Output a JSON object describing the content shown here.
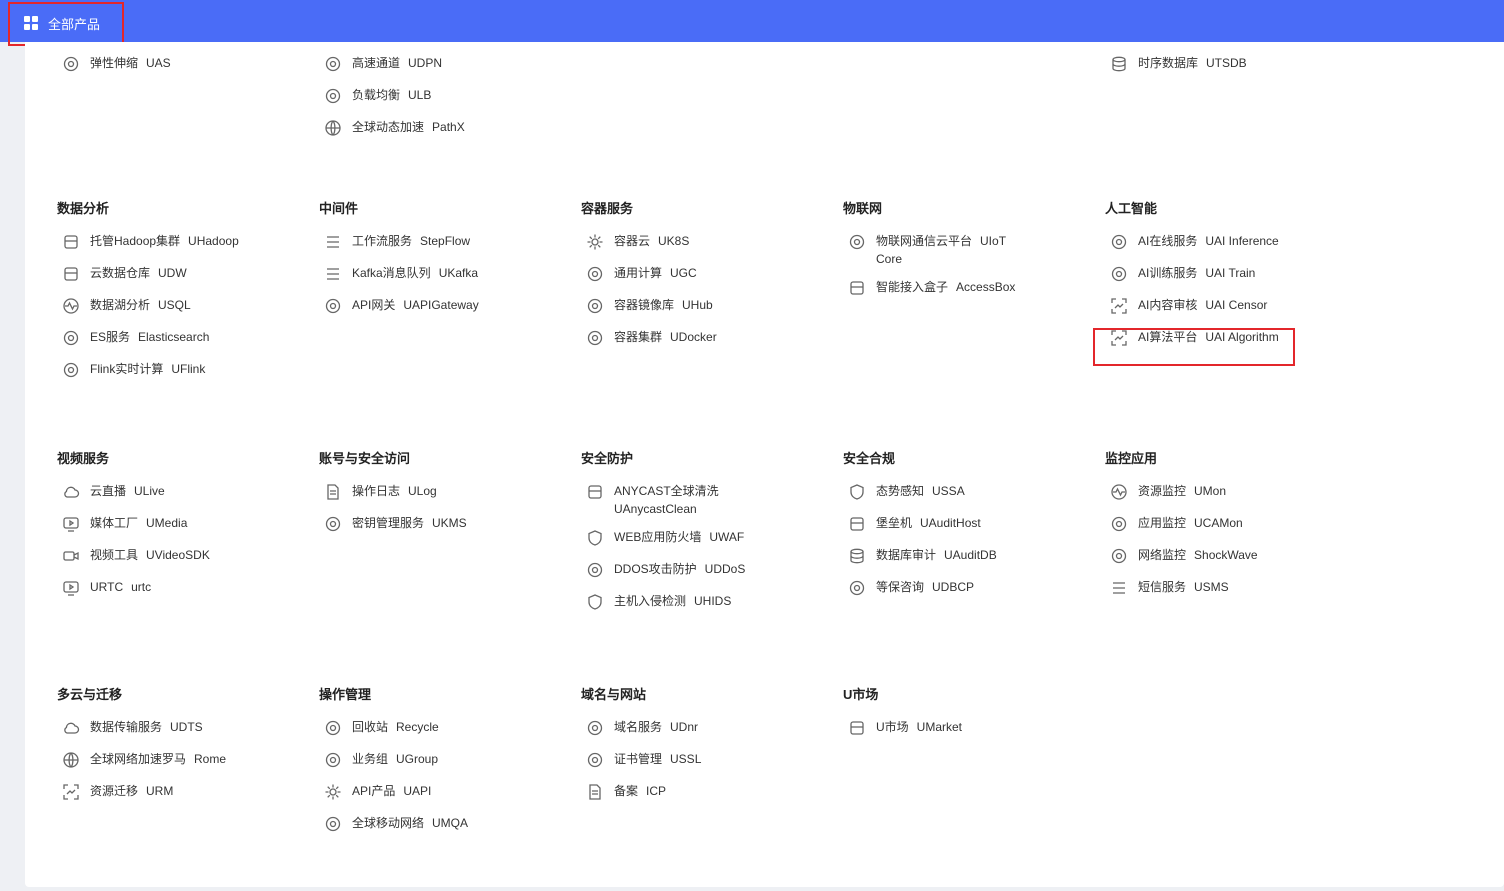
{
  "topbar": {
    "all_products_label": "全部产品"
  },
  "rows": [
    [
      {
        "title": "",
        "items": [
          {
            "name": "弹性伸缩",
            "code": "UAS",
            "icon": "scale-icon"
          }
        ]
      },
      {
        "title": "",
        "items": [
          {
            "name": "高速通道",
            "code": "UDPN",
            "icon": "channel-icon"
          },
          {
            "name": "负载均衡",
            "code": "ULB",
            "icon": "balance-icon"
          },
          {
            "name": "全球动态加速",
            "code": "PathX",
            "icon": "accelerate-icon"
          }
        ]
      },
      {
        "title": "",
        "items": []
      },
      {
        "title": "",
        "items": []
      },
      {
        "title": "",
        "items": [
          {
            "name": "时序数据库",
            "code": "UTSDB",
            "icon": "database-icon"
          }
        ]
      }
    ],
    [
      {
        "title": "数据分析",
        "items": [
          {
            "name": "托管Hadoop集群",
            "code": "UHadoop",
            "icon": "hadoop-icon"
          },
          {
            "name": "云数据仓库",
            "code": "UDW",
            "icon": "warehouse-icon"
          },
          {
            "name": "数据湖分析",
            "code": "USQL",
            "icon": "lake-icon"
          },
          {
            "name": "ES服务",
            "code": "Elasticsearch",
            "icon": "es-icon"
          },
          {
            "name": "Flink实时计算",
            "code": "UFlink",
            "icon": "flink-icon"
          }
        ]
      },
      {
        "title": "中间件",
        "items": [
          {
            "name": "工作流服务",
            "code": "StepFlow",
            "icon": "workflow-icon"
          },
          {
            "name": "Kafka消息队列",
            "code": "UKafka",
            "icon": "queue-icon"
          },
          {
            "name": "API网关",
            "code": "UAPIGateway",
            "icon": "gateway-icon"
          }
        ]
      },
      {
        "title": "容器服务",
        "items": [
          {
            "name": "容器云",
            "code": "UK8S",
            "icon": "k8s-icon"
          },
          {
            "name": "通用计算",
            "code": "UGC",
            "icon": "compute-icon"
          },
          {
            "name": "容器镜像库",
            "code": "UHub",
            "icon": "hub-icon"
          },
          {
            "name": "容器集群",
            "code": "UDocker",
            "icon": "docker-icon"
          }
        ]
      },
      {
        "title": "物联网",
        "items": [
          {
            "name": "物联网通信云平台",
            "code": "UIoT Core",
            "icon": "iot-icon"
          },
          {
            "name": "智能接入盒子",
            "code": "AccessBox",
            "icon": "box-icon"
          }
        ]
      },
      {
        "title": "人工智能",
        "items": [
          {
            "name": "AI在线服务",
            "code": "UAI Inference",
            "icon": "brain-icon"
          },
          {
            "name": "AI训练服务",
            "code": "UAI Train",
            "icon": "ai-chip-icon"
          },
          {
            "name": "AI内容审核",
            "code": "UAI Censor",
            "icon": "scan-icon"
          },
          {
            "name": "AI算法平台",
            "code": "UAI Algorithm",
            "icon": "scan-face-icon"
          }
        ]
      }
    ],
    [
      {
        "title": "视频服务",
        "items": [
          {
            "name": "云直播",
            "code": "ULive",
            "icon": "cloud-live-icon"
          },
          {
            "name": "媒体工厂",
            "code": "UMedia",
            "icon": "media-icon"
          },
          {
            "name": "视频工具",
            "code": "UVideoSDK",
            "icon": "camera-icon"
          },
          {
            "name": "URTC",
            "code": "urtc",
            "icon": "screen-play-icon"
          }
        ]
      },
      {
        "title": "账号与安全访问",
        "items": [
          {
            "name": "操作日志",
            "code": "ULog",
            "icon": "log-icon"
          },
          {
            "name": "密钥管理服务",
            "code": "UKMS",
            "icon": "key-icon"
          }
        ]
      },
      {
        "title": "安全防护",
        "items": [
          {
            "name": "ANYCAST全球清洗",
            "code": "UAnycastClean",
            "icon": "basket-icon"
          },
          {
            "name": "WEB应用防火墙",
            "code": "UWAF",
            "icon": "shield-icon"
          },
          {
            "name": "DDOS攻击防护",
            "code": "UDDoS",
            "icon": "ddos-icon"
          },
          {
            "name": "主机入侵检测",
            "code": "UHIDS",
            "icon": "host-shield-icon"
          }
        ]
      },
      {
        "title": "安全合规",
        "items": [
          {
            "name": "态势感知",
            "code": "USSA",
            "icon": "shield-check-icon"
          },
          {
            "name": "堡垒机",
            "code": "UAuditHost",
            "icon": "castle-icon"
          },
          {
            "name": "数据库审计",
            "code": "UAuditDB",
            "icon": "db-audit-icon"
          },
          {
            "name": "等保咨询",
            "code": "UDBCP",
            "icon": "consult-icon"
          }
        ]
      },
      {
        "title": "监控应用",
        "items": [
          {
            "name": "资源监控",
            "code": "UMon",
            "icon": "pulse-icon"
          },
          {
            "name": "应用监控",
            "code": "UCAMon",
            "icon": "gauge-icon"
          },
          {
            "name": "网络监控",
            "code": "ShockWave",
            "icon": "wave-icon"
          },
          {
            "name": "短信服务",
            "code": "USMS",
            "icon": "sms-icon"
          }
        ]
      }
    ],
    [
      {
        "title": "多云与迁移",
        "items": [
          {
            "name": "数据传输服务",
            "code": "UDTS",
            "icon": "cloud-transfer-icon"
          },
          {
            "name": "全球网络加速罗马",
            "code": "Rome",
            "icon": "globe-icon"
          },
          {
            "name": "资源迁移",
            "code": "URM",
            "icon": "migrate-icon"
          }
        ]
      },
      {
        "title": "操作管理",
        "items": [
          {
            "name": "回收站",
            "code": "Recycle",
            "icon": "recycle-icon"
          },
          {
            "name": "业务组",
            "code": "UGroup",
            "icon": "group-icon"
          },
          {
            "name": "API产品",
            "code": "UAPI",
            "icon": "api-icon"
          },
          {
            "name": "全球移动网络",
            "code": "UMQA",
            "icon": "mobile-net-icon"
          }
        ]
      },
      {
        "title": "域名与网站",
        "items": [
          {
            "name": "域名服务",
            "code": "UDnr",
            "icon": "dns-icon"
          },
          {
            "name": "证书管理",
            "code": "USSL",
            "icon": "ssl-icon"
          },
          {
            "name": "备案",
            "code": "ICP",
            "icon": "icp-icon"
          }
        ]
      },
      {
        "title": "U市场",
        "items": [
          {
            "name": "U市场",
            "code": "UMarket",
            "icon": "market-icon"
          }
        ]
      },
      {
        "title": "",
        "items": []
      }
    ]
  ]
}
